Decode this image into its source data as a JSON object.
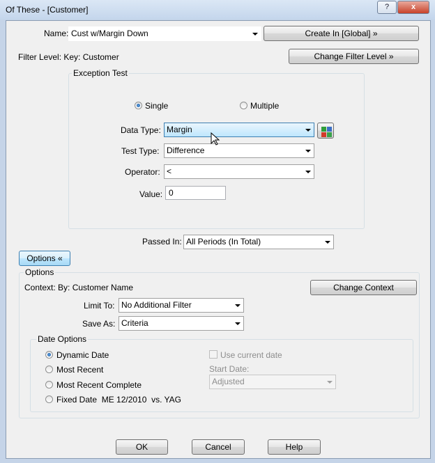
{
  "window": {
    "title": "Of These - [Customer]",
    "help_glyph": "?",
    "close_glyph": "x"
  },
  "header": {
    "name_label": "Name:",
    "name_value": "Cust w/Margin Down",
    "create_in_button": "Create In [Global] »",
    "filter_level_text": "Filter Level: Key: Customer",
    "change_filter_button": "Change Filter Level »"
  },
  "exception_test": {
    "title": "Exception Test",
    "single_label": "Single",
    "multiple_label": "Multiple",
    "selected_mode": "single",
    "data_type_label": "Data Type:",
    "data_type_value": "Margin",
    "test_type_label": "Test Type:",
    "test_type_value": "Difference",
    "operator_label": "Operator:",
    "operator_value": "<",
    "value_label": "Value:",
    "value_value": "0"
  },
  "passed_in": {
    "label": "Passed In:",
    "value": "All Periods (In Total)"
  },
  "options_toggle": "Options «",
  "options": {
    "title": "Options",
    "context_text": "Context: By: Customer Name",
    "change_context_button": "Change Context",
    "limit_to_label": "Limit To:",
    "limit_to_value": "No Additional Filter",
    "save_as_label": "Save As:",
    "save_as_value": "Criteria"
  },
  "date_options": {
    "title": "Date Options",
    "radios": [
      {
        "label": "Dynamic Date",
        "selected": true
      },
      {
        "label": "Most Recent",
        "selected": false
      },
      {
        "label": "Most Recent Complete",
        "selected": false
      },
      {
        "label": "Fixed Date  ME 12/2010  vs. YAG",
        "selected": false
      }
    ],
    "use_current_date_label": "Use current date",
    "start_date_label": "Start Date:",
    "start_date_value": "Adjusted"
  },
  "footer": {
    "ok": "OK",
    "cancel": "Cancel",
    "help": "Help"
  },
  "colors": {
    "accent": "#3c7fb1",
    "frame": "#c5d4e8",
    "client": "#f0f0f0"
  }
}
